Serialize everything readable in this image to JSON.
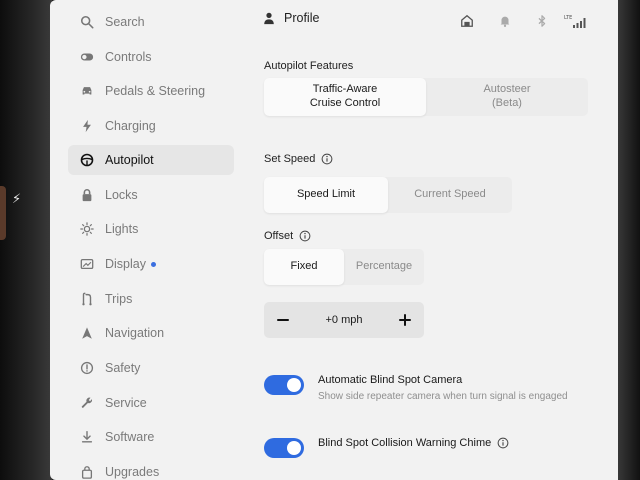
{
  "sidebar": {
    "items": [
      {
        "label": "Search",
        "icon": "search-icon"
      },
      {
        "label": "Controls",
        "icon": "toggle-icon"
      },
      {
        "label": "Pedals & Steering",
        "icon": "car-icon"
      },
      {
        "label": "Charging",
        "icon": "bolt-icon"
      },
      {
        "label": "Autopilot",
        "icon": "steering-wheel-icon",
        "active": true
      },
      {
        "label": "Locks",
        "icon": "lock-icon"
      },
      {
        "label": "Lights",
        "icon": "sun-icon"
      },
      {
        "label": "Display",
        "icon": "display-icon",
        "has_dot": true
      },
      {
        "label": "Trips",
        "icon": "trips-icon"
      },
      {
        "label": "Navigation",
        "icon": "navigation-icon"
      },
      {
        "label": "Safety",
        "icon": "safety-icon"
      },
      {
        "label": "Service",
        "icon": "wrench-icon"
      },
      {
        "label": "Software",
        "icon": "download-icon"
      },
      {
        "label": "Upgrades",
        "icon": "bag-icon"
      }
    ]
  },
  "header": {
    "profile_label": "Profile",
    "status_icons": [
      "home-icon",
      "bell-icon",
      "bluetooth-icon",
      "lte-signal-icon"
    ],
    "lte_label": "LTE"
  },
  "autopilot_features": {
    "title": "Autopilot Features",
    "options": [
      {
        "label": "Traffic-Aware\nCruise Control",
        "line1": "Traffic-Aware",
        "line2": "Cruise Control",
        "selected": true
      },
      {
        "label": "Autosteer\n(Beta)",
        "line1": "Autosteer",
        "line2": "(Beta)",
        "selected": false
      }
    ]
  },
  "set_speed": {
    "title": "Set Speed",
    "options": [
      {
        "label": "Speed Limit",
        "selected": true
      },
      {
        "label": "Current Speed",
        "selected": false
      }
    ]
  },
  "offset": {
    "title": "Offset",
    "options": [
      {
        "label": "Fixed",
        "selected": true
      },
      {
        "label": "Percentage",
        "selected": false
      }
    ],
    "stepper": {
      "minus": "−",
      "value": "+0 mph",
      "plus": "+"
    }
  },
  "toggles": [
    {
      "label": "Automatic Blind Spot Camera",
      "description": "Show side repeater camera when turn signal is engaged",
      "enabled": true
    },
    {
      "label": "Blind Spot Collision Warning Chime",
      "enabled": true
    }
  ],
  "colors": {
    "accent": "#2f6be0",
    "screen_bg": "#f2f2f2",
    "selected_segment": "#fafafa"
  }
}
